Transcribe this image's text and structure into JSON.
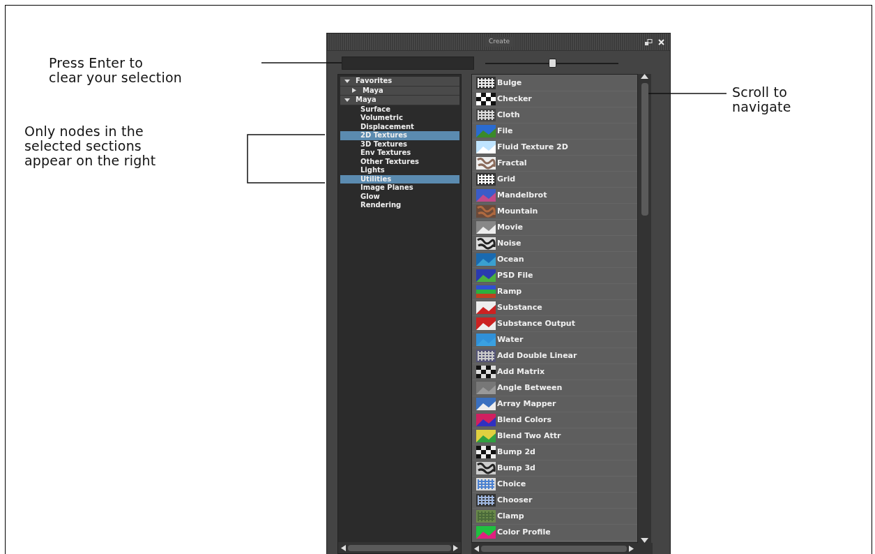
{
  "callouts": [
    {
      "text": "Press Enter to\nclear your selection"
    },
    {
      "text": "Only nodes in the\nselected sections\nappear on the right"
    },
    {
      "text": "Scroll to\nnavigate"
    }
  ],
  "panel": {
    "title": "Create",
    "slider": {
      "level": 0.5
    },
    "tree": [
      {
        "label": "Favorites",
        "expanded": true,
        "children": [
          {
            "label": "Maya",
            "expanded": false
          }
        ]
      },
      {
        "label": "Maya",
        "expanded": true,
        "children": [
          {
            "label": "Surface",
            "selected": false
          },
          {
            "label": "Volumetric",
            "selected": false
          },
          {
            "label": "Displacement",
            "selected": false
          },
          {
            "label": "2D Textures",
            "selected": true
          },
          {
            "label": "3D Textures",
            "selected": false
          },
          {
            "label": "Env Textures",
            "selected": false
          },
          {
            "label": "Other Textures",
            "selected": false
          },
          {
            "label": "Lights",
            "selected": false
          },
          {
            "label": "Utilities",
            "selected": true
          },
          {
            "label": "Image Planes",
            "selected": false
          },
          {
            "label": "Glow",
            "selected": false
          },
          {
            "label": "Rendering",
            "selected": false
          }
        ]
      }
    ],
    "nodes": [
      {
        "label": "Bulge"
      },
      {
        "label": "Checker"
      },
      {
        "label": "Cloth"
      },
      {
        "label": "File"
      },
      {
        "label": "Fluid Texture 2D"
      },
      {
        "label": "Fractal"
      },
      {
        "label": "Grid"
      },
      {
        "label": "Mandelbrot"
      },
      {
        "label": "Mountain"
      },
      {
        "label": "Movie"
      },
      {
        "label": "Noise"
      },
      {
        "label": "Ocean"
      },
      {
        "label": "PSD File"
      },
      {
        "label": "Ramp"
      },
      {
        "label": "Substance"
      },
      {
        "label": "Substance Output"
      },
      {
        "label": "Water"
      },
      {
        "label": "Add Double Linear"
      },
      {
        "label": "Add Matrix"
      },
      {
        "label": "Angle Between"
      },
      {
        "label": "Array Mapper"
      },
      {
        "label": "Blend Colors"
      },
      {
        "label": "Blend Two Attr"
      },
      {
        "label": "Bump 2d"
      },
      {
        "label": "Bump 3d"
      },
      {
        "label": "Choice"
      },
      {
        "label": "Chooser"
      },
      {
        "label": "Clamp"
      },
      {
        "label": "Color Profile"
      }
    ]
  }
}
